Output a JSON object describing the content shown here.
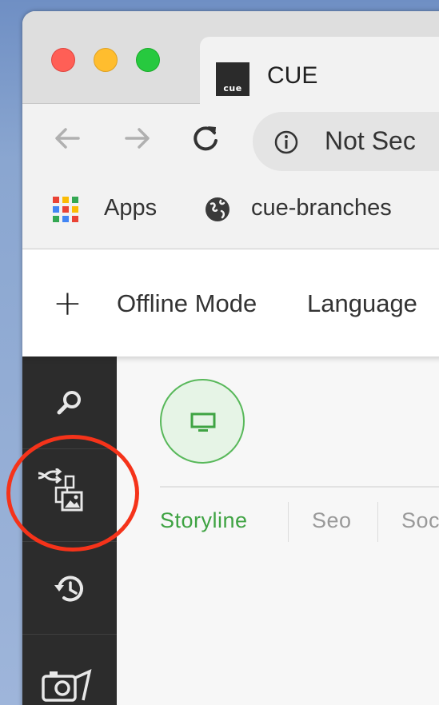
{
  "browser": {
    "tab_title": "CUE",
    "favicon_text": "cue",
    "address_text": "Not Sec",
    "bookmarks": [
      {
        "label": "Apps",
        "icon": "apps-grid-icon"
      },
      {
        "label": "cue-branches",
        "icon": "globe-icon"
      }
    ]
  },
  "app": {
    "menu": {
      "add_icon": "plus-icon",
      "offline_mode": "Offline Mode",
      "language": "Language"
    },
    "sidebar": [
      {
        "icon": "search-icon"
      },
      {
        "icon": "media-switch-icon"
      },
      {
        "icon": "history-icon"
      },
      {
        "icon": "camera-icon"
      }
    ],
    "device_icon": "desktop-monitor-icon",
    "tabs": [
      {
        "label": "Storyline",
        "active": true
      },
      {
        "label": "Seo",
        "active": false
      },
      {
        "label": "Soc",
        "active": false
      }
    ]
  },
  "colors": {
    "accent_green": "#3fa343",
    "sidebar_bg": "#2c2c2c",
    "annotation_red": "#f5331a"
  }
}
